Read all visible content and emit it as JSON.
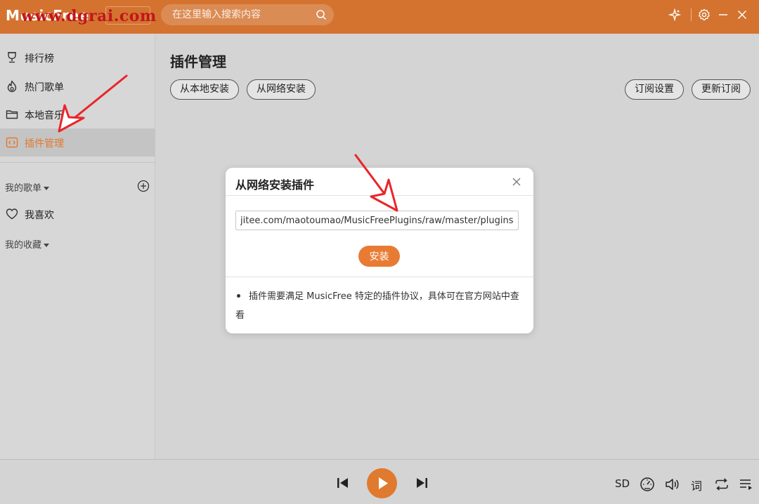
{
  "app": {
    "name": "MusicFree",
    "watermark": "www.dgrai.com"
  },
  "search": {
    "placeholder": "在这里输入搜索内容"
  },
  "titlebar_icons": [
    "sparkle-icon",
    "gear-icon",
    "minimize-icon",
    "close-icon"
  ],
  "sidebar": {
    "items": [
      {
        "label": "排行榜",
        "icon": "trophy-icon"
      },
      {
        "label": "热门歌单",
        "icon": "fire-icon"
      },
      {
        "label": "本地音乐",
        "icon": "folder-icon"
      },
      {
        "label": "插件管理",
        "icon": "code-icon",
        "active": true
      }
    ],
    "my_playlists_label": "我的歌单",
    "favorite_label": "我喜欢",
    "collections_label": "我的收藏"
  },
  "main": {
    "title": "插件管理",
    "buttons": {
      "local_install": "从本地安装",
      "network_install": "从网络安装",
      "subscribe_settings": "订阅设置",
      "update_subscription": "更新订阅"
    }
  },
  "modal": {
    "title": "从网络安装插件",
    "url_value": "jitee.com/maotoumao/MusicFreePlugins/raw/master/plugins.json",
    "install_label": "安装",
    "note": "插件需要满足 MusicFree 特定的插件协议，具体可在官方网站中查看"
  },
  "player": {
    "quality_label": "SD",
    "lyric_label": "词"
  },
  "colors": {
    "accent": "#e07a2f",
    "titlebar": "#d4732f",
    "annotation": "#e8262b"
  }
}
